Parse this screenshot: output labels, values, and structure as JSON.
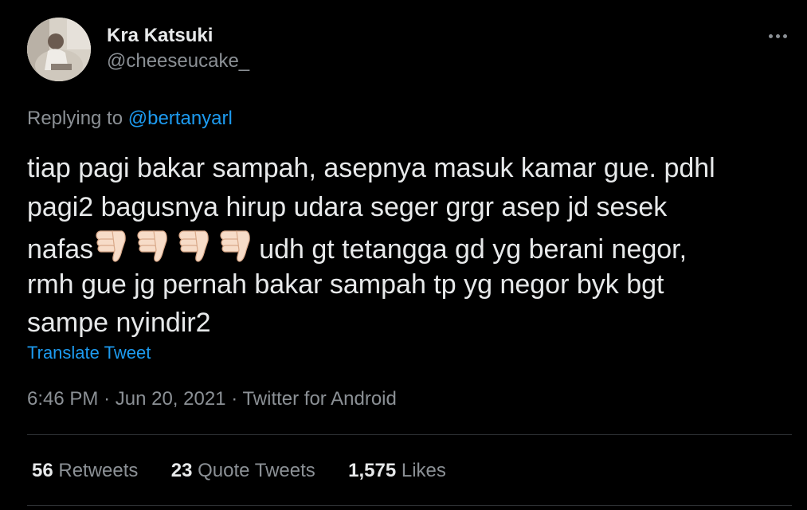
{
  "author": {
    "display_name": "Kra Katsuki",
    "username": "@cheeseucake_"
  },
  "reply": {
    "prefix": "Replying to",
    "mention": "@bertanyarl"
  },
  "tweet": {
    "line1": "tiap pagi bakar sampah, asepnya masuk kamar gue. pdhl",
    "line2": "pagi2 bagusnya hirup udara seger grgr asep jd sesek",
    "line3_start": "nafas",
    "line3_emoji": [
      "thumbs-down-icon",
      "thumbs-down-icon",
      "thumbs-down-icon",
      "thumbs-down-icon"
    ],
    "line3_end": "udh gt tetangga gd yg berani negor,",
    "line4": "rmh gue jg pernah bakar sampah tp yg negor byk bgt",
    "line5": "sampe nyindir2"
  },
  "translate_label": "Translate Tweet",
  "meta": {
    "time": "6:46 PM",
    "date": "Jun 20, 2021",
    "source": "Twitter for Android",
    "separator": "·"
  },
  "stats": {
    "retweets_count": "56",
    "retweets_label": "Retweets",
    "quotes_count": "23",
    "quotes_label": "Quote Tweets",
    "likes_count": "1,575",
    "likes_label": "Likes"
  },
  "colors": {
    "background": "#000000",
    "text": "#e7e9ea",
    "muted": "#8b9095",
    "link": "#1d9bf0",
    "divider": "#2f3336"
  }
}
